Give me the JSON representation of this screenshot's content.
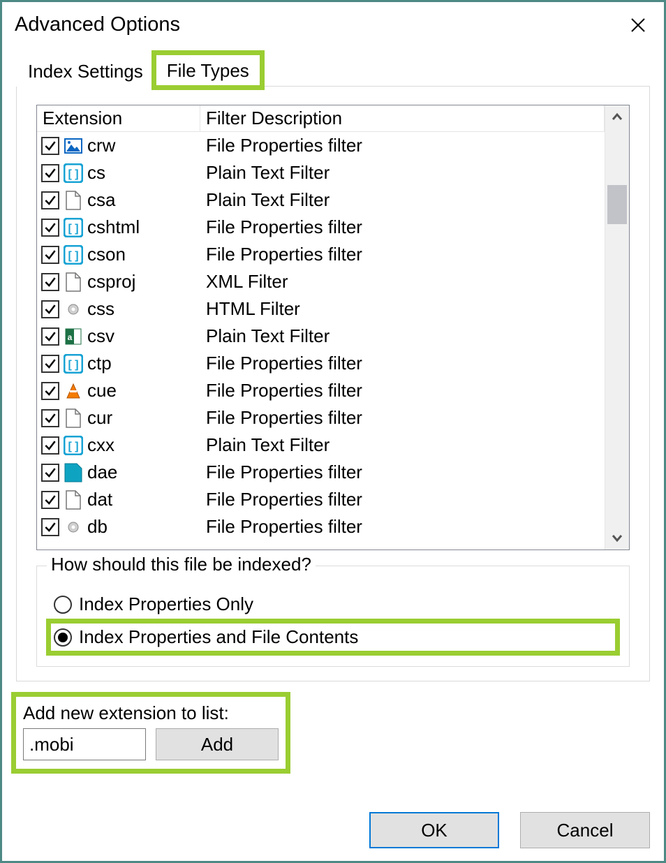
{
  "window": {
    "title": "Advanced Options"
  },
  "tabs": [
    {
      "label": "Index Settings",
      "active": false
    },
    {
      "label": "File Types",
      "active": true,
      "highlighted": true
    }
  ],
  "list": {
    "columns": {
      "ext": "Extension",
      "desc": "Filter Description"
    },
    "rows": [
      {
        "checked": true,
        "icon": "image",
        "ext": "crw",
        "desc": "File Properties filter"
      },
      {
        "checked": true,
        "icon": "bracket",
        "ext": "cs",
        "desc": "Plain Text Filter"
      },
      {
        "checked": true,
        "icon": "blank",
        "ext": "csa",
        "desc": "Plain Text Filter"
      },
      {
        "checked": true,
        "icon": "bracket",
        "ext": "cshtml",
        "desc": "File Properties filter"
      },
      {
        "checked": true,
        "icon": "bracket",
        "ext": "cson",
        "desc": "File Properties filter"
      },
      {
        "checked": true,
        "icon": "blank",
        "ext": "csproj",
        "desc": "XML Filter"
      },
      {
        "checked": true,
        "icon": "gear",
        "ext": "css",
        "desc": "HTML Filter"
      },
      {
        "checked": true,
        "icon": "excel",
        "ext": "csv",
        "desc": "Plain Text Filter"
      },
      {
        "checked": true,
        "icon": "bracket",
        "ext": "ctp",
        "desc": "File Properties filter"
      },
      {
        "checked": true,
        "icon": "cone",
        "ext": "cue",
        "desc": "File Properties filter"
      },
      {
        "checked": true,
        "icon": "blank",
        "ext": "cur",
        "desc": "File Properties filter"
      },
      {
        "checked": true,
        "icon": "bracket",
        "ext": "cxx",
        "desc": "Plain Text Filter"
      },
      {
        "checked": true,
        "icon": "fold",
        "ext": "dae",
        "desc": "File Properties filter"
      },
      {
        "checked": true,
        "icon": "blank",
        "ext": "dat",
        "desc": "File Properties filter"
      },
      {
        "checked": true,
        "icon": "gear",
        "ext": "db",
        "desc": "File Properties filter"
      }
    ]
  },
  "index_group": {
    "title": "How should this file be indexed?",
    "options": [
      {
        "label": "Index Properties Only",
        "checked": false,
        "highlighted": false
      },
      {
        "label": "Index Properties and File Contents",
        "checked": true,
        "highlighted": true
      }
    ]
  },
  "add_ext": {
    "label": "Add new extension to list:",
    "value": ".mobi",
    "button": "Add",
    "highlighted": true
  },
  "footer": {
    "ok": "OK",
    "cancel": "Cancel"
  }
}
